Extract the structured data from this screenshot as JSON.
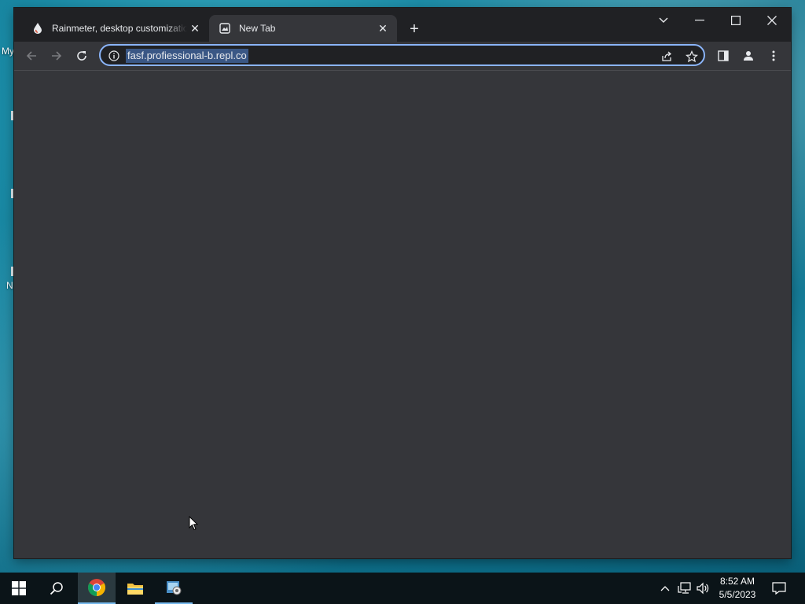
{
  "desktop": {
    "labels": [
      "My",
      "N"
    ]
  },
  "browser": {
    "tabs": [
      {
        "title": "Rainmeter, desktop customization tool",
        "favicon": "rainmeter-drop-icon",
        "active": false
      },
      {
        "title": "New Tab",
        "favicon": "new-tab-page-icon",
        "active": true
      }
    ],
    "new_tab_symbol": "+",
    "window_controls": [
      "tab-search",
      "minimize",
      "maximize",
      "close"
    ],
    "address_bar": {
      "url": "fasf.profiessional-b.repl.co",
      "selected": true,
      "accent": "#8ab4f8"
    },
    "colors": {
      "frame": "#202124",
      "toolbar": "#35363a",
      "content": "#35363a"
    }
  },
  "taskbar": {
    "pinned": [
      "windows-start-icon",
      "search-icon",
      "chrome-icon",
      "file-explorer-icon",
      "control-panel-icon"
    ],
    "clock": {
      "time": "8:52 AM",
      "date": "5/5/2023"
    }
  }
}
